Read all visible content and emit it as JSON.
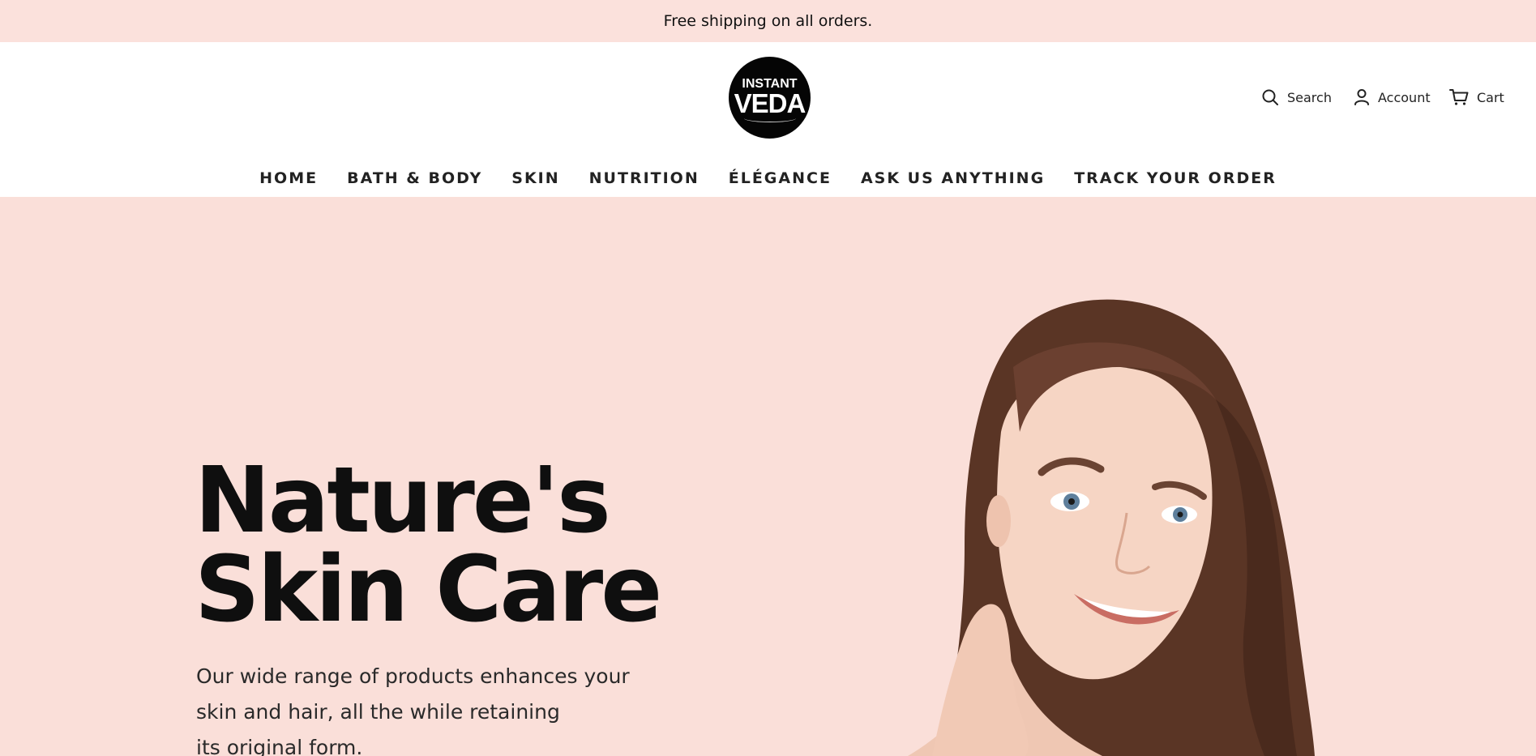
{
  "announcement": {
    "text": "Free shipping on all orders."
  },
  "brand": {
    "logo_line1": "INSTANT",
    "logo_line2": "VEDA"
  },
  "utility": {
    "search": "Search",
    "account": "Account",
    "cart": "Cart"
  },
  "nav": {
    "items": [
      {
        "label": "HOME"
      },
      {
        "label": "BATH & BODY"
      },
      {
        "label": "SKIN"
      },
      {
        "label": "NUTRITION"
      },
      {
        "label": "ÉLÉGANCE"
      },
      {
        "label": "ASK US ANYTHING"
      },
      {
        "label": "TRACK YOUR ORDER"
      }
    ]
  },
  "hero": {
    "title_line1": "Nature's",
    "title_line2": "Skin Care",
    "body_line1": "Our wide range of products enhances your",
    "body_line2": "skin and hair, all the while retaining",
    "body_line3": "its original form."
  },
  "colors": {
    "announcement_bg": "#fbe1dc",
    "hero_bg": "#fadfd9",
    "text": "#222222",
    "logo_bg": "#050505"
  },
  "icons": [
    "search-icon",
    "account-icon",
    "cart-icon"
  ]
}
